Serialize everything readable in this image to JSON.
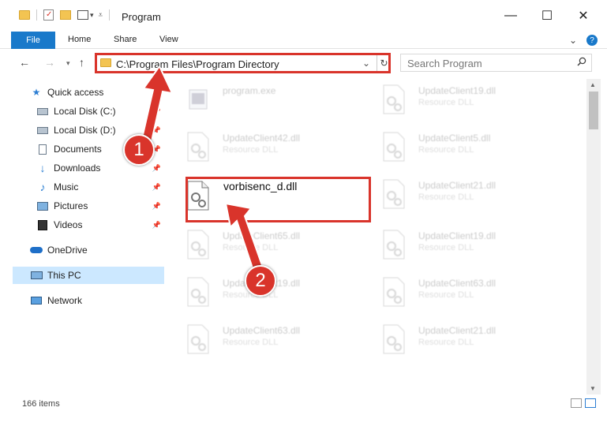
{
  "window": {
    "title": "Program",
    "minimize_glyph": "—",
    "maximize_glyph": "☐",
    "close_glyph": "✕"
  },
  "ribbon": {
    "tabs": [
      "File",
      "Home",
      "Share",
      "View"
    ],
    "collapse_glyph": "⌄",
    "help_glyph": "?"
  },
  "address": {
    "path": "C:\\Program Files\\Program Directory",
    "chevron": "⌄",
    "refresh": "↻"
  },
  "search": {
    "placeholder": "Search Program",
    "icon": "search-icon"
  },
  "sidebar": {
    "items": [
      {
        "label": "Quick access",
        "icon": "star-icon"
      },
      {
        "label": "Local Disk (C:)",
        "icon": "drive-icon",
        "pinned": true
      },
      {
        "label": "Local Disk (D:)",
        "icon": "drive-icon",
        "pinned": true
      },
      {
        "label": "Documents",
        "icon": "document-icon",
        "pinned": true
      },
      {
        "label": "Downloads",
        "icon": "download-icon",
        "pinned": true
      },
      {
        "label": "Music",
        "icon": "music-icon",
        "pinned": true
      },
      {
        "label": "Pictures",
        "icon": "pictures-icon",
        "pinned": true
      },
      {
        "label": "Videos",
        "icon": "video-icon",
        "pinned": true
      },
      {
        "label": "OneDrive",
        "icon": "cloud-icon"
      },
      {
        "label": "This PC",
        "icon": "computer-icon",
        "selected": true
      },
      {
        "label": "Network",
        "icon": "network-icon"
      }
    ]
  },
  "files": {
    "left": [
      {
        "name": "program.exe",
        "type": ""
      },
      {
        "name": "UpdateClient42.dll",
        "type": "Resource DLL"
      },
      {
        "name": "vorbisenc_d.dll",
        "type": ""
      },
      {
        "name": "UpdateClient65.dll",
        "type": "Resource DLL"
      },
      {
        "name": "UpdateClient19.dll",
        "type": "Resource DLL"
      },
      {
        "name": "UpdateClient63.dll",
        "type": "Resource DLL"
      }
    ],
    "right": [
      {
        "name": "UpdateClient19.dll",
        "type": "Resource DLL"
      },
      {
        "name": "UpdateClient5.dll",
        "type": "Resource DLL"
      },
      {
        "name": "UpdateClient21.dll",
        "type": "Resource DLL"
      },
      {
        "name": "UpdateClient19.dll",
        "type": "Resource DLL"
      },
      {
        "name": "UpdateClient63.dll",
        "type": "Resource DLL"
      },
      {
        "name": "UpdateClient21.dll",
        "type": "Resource DLL"
      }
    ]
  },
  "status": {
    "count": "166 items"
  },
  "callouts": {
    "one": "1",
    "two": "2"
  },
  "colors": {
    "accent": "#1979ca",
    "highlight": "#d9342b",
    "selected_nav": "#cce8ff"
  }
}
